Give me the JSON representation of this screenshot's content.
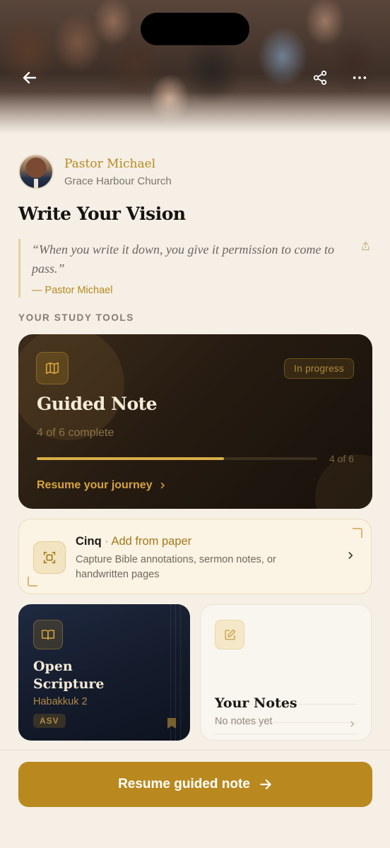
{
  "header": {
    "back_icon": "arrow-left-icon",
    "share_icon": "share-icon",
    "more_icon": "more-horizontal-icon"
  },
  "author": {
    "name": "Pastor Michael",
    "church": "Grace Harbour Church"
  },
  "page_title": "Write Your Vision",
  "quote": {
    "text": "“When you write it down, you give it permission to come to pass.”",
    "attribution": "— Pastor Michael"
  },
  "section_label": "YOUR STUDY TOOLS",
  "guided_note": {
    "badge": "In progress",
    "title": "Guided Note",
    "subtitle": "4 of 6 complete",
    "progress_fraction": 0.667,
    "progress_label": "4 of 6",
    "resume_label": "Resume your journey"
  },
  "cinq": {
    "brand": "Cinq",
    "separator": " · ",
    "action": "Add from paper",
    "description": "Capture Bible annotations, sermon notes, or handwritten pages"
  },
  "scripture": {
    "title": "Open Scripture",
    "reference": "Habakkuk 2",
    "version": "ASV"
  },
  "notes": {
    "title": "Your Notes",
    "subtitle": "No notes yet"
  },
  "cta": {
    "label": "Resume guided note"
  },
  "colors": {
    "accent": "#b9891f",
    "background": "#f5efe6",
    "guided_card": "#261b11",
    "scripture_card": "#141b2b"
  }
}
